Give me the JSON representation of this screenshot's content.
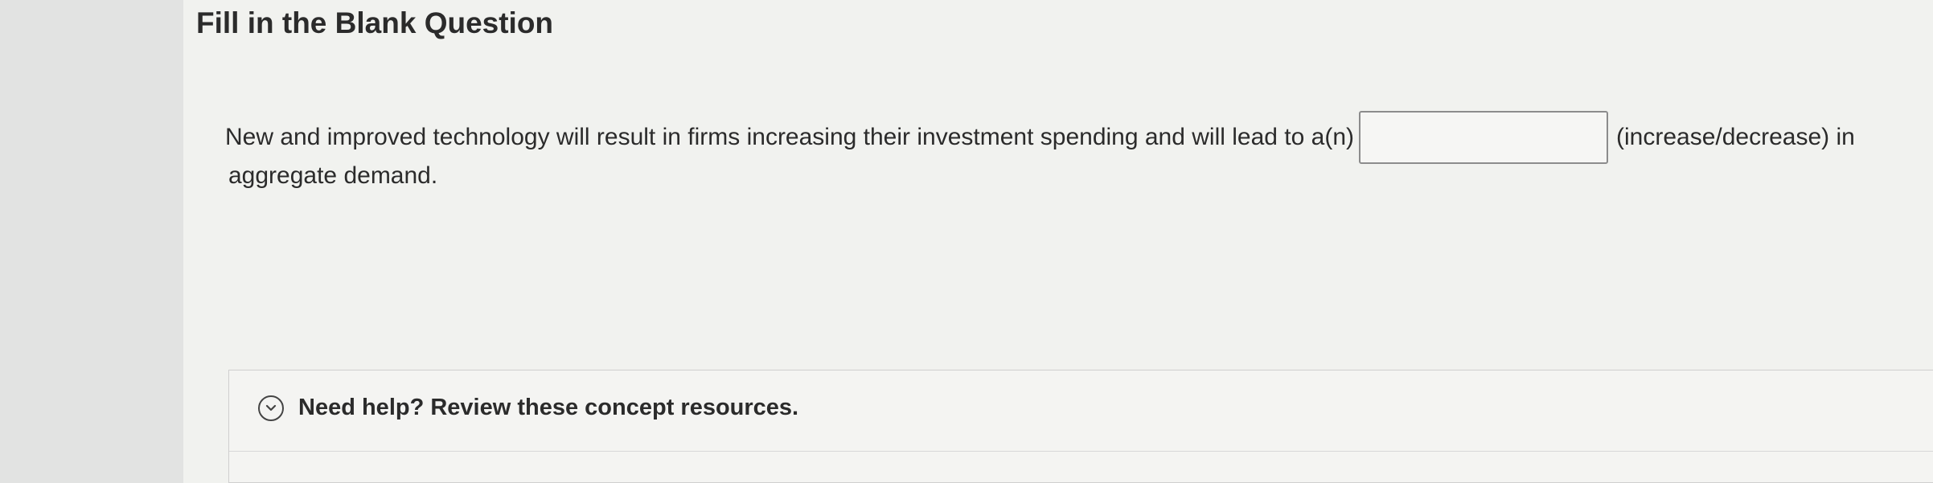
{
  "question": {
    "title": "Fill in the Blank Question",
    "text_before_blank": "New and improved technology will result in firms increasing their investment spending and will lead to a(n)",
    "blank": {
      "value": "",
      "placeholder": ""
    },
    "text_after_blank": "(increase/decrease) in",
    "text_line2": "aggregate demand."
  },
  "help": {
    "icon": "chevron-down-circle-icon",
    "label": "Need help? Review these concept resources."
  }
}
